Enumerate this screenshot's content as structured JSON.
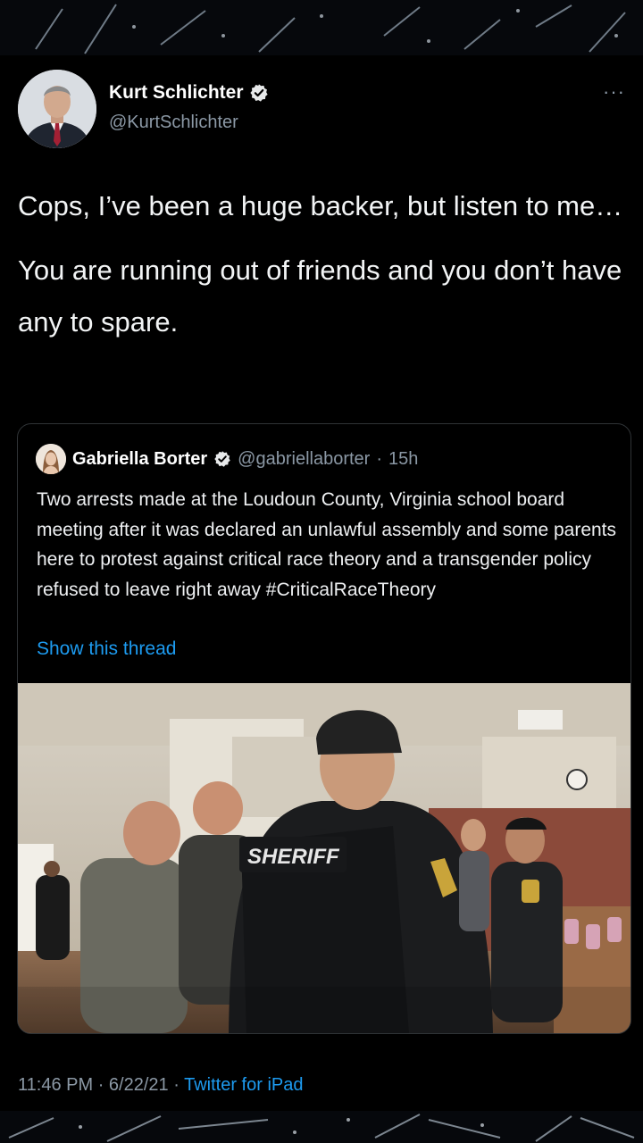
{
  "author": {
    "name": "Kurt Schlichter",
    "handle": "@KurtSchlichter",
    "verified": true
  },
  "tweet": {
    "paragraphs": [
      "Cops, I’ve been a huge backer, but listen to me…",
      "You are running out of friends and you don’t have any to spare."
    ],
    "time": "11:46 PM",
    "date": "6/22/21",
    "separator": "·",
    "source": "Twitter for iPad"
  },
  "quoted": {
    "name": "Gabriella Borter",
    "handle": "@gabriellaborter",
    "separator": "·",
    "age": "15h",
    "text": "Two arrests made at the Loudoun County, Virginia school board meeting after it was declared an unlawful assembly and some parents here to protest against critical race theory and a transgender policy refused to leave right away #CriticalRaceTheory",
    "show_thread": "Show this thread",
    "media_vest_text": "SHERIFF"
  },
  "more_menu": "···",
  "icons": {
    "verified": "verified-badge-icon",
    "more": "more-options-icon"
  },
  "colors": {
    "background": "#000000",
    "text": "#e7e9ea",
    "secondary_text": "#8b98a5",
    "link": "#1d9bf0",
    "border": "#2f3336"
  }
}
